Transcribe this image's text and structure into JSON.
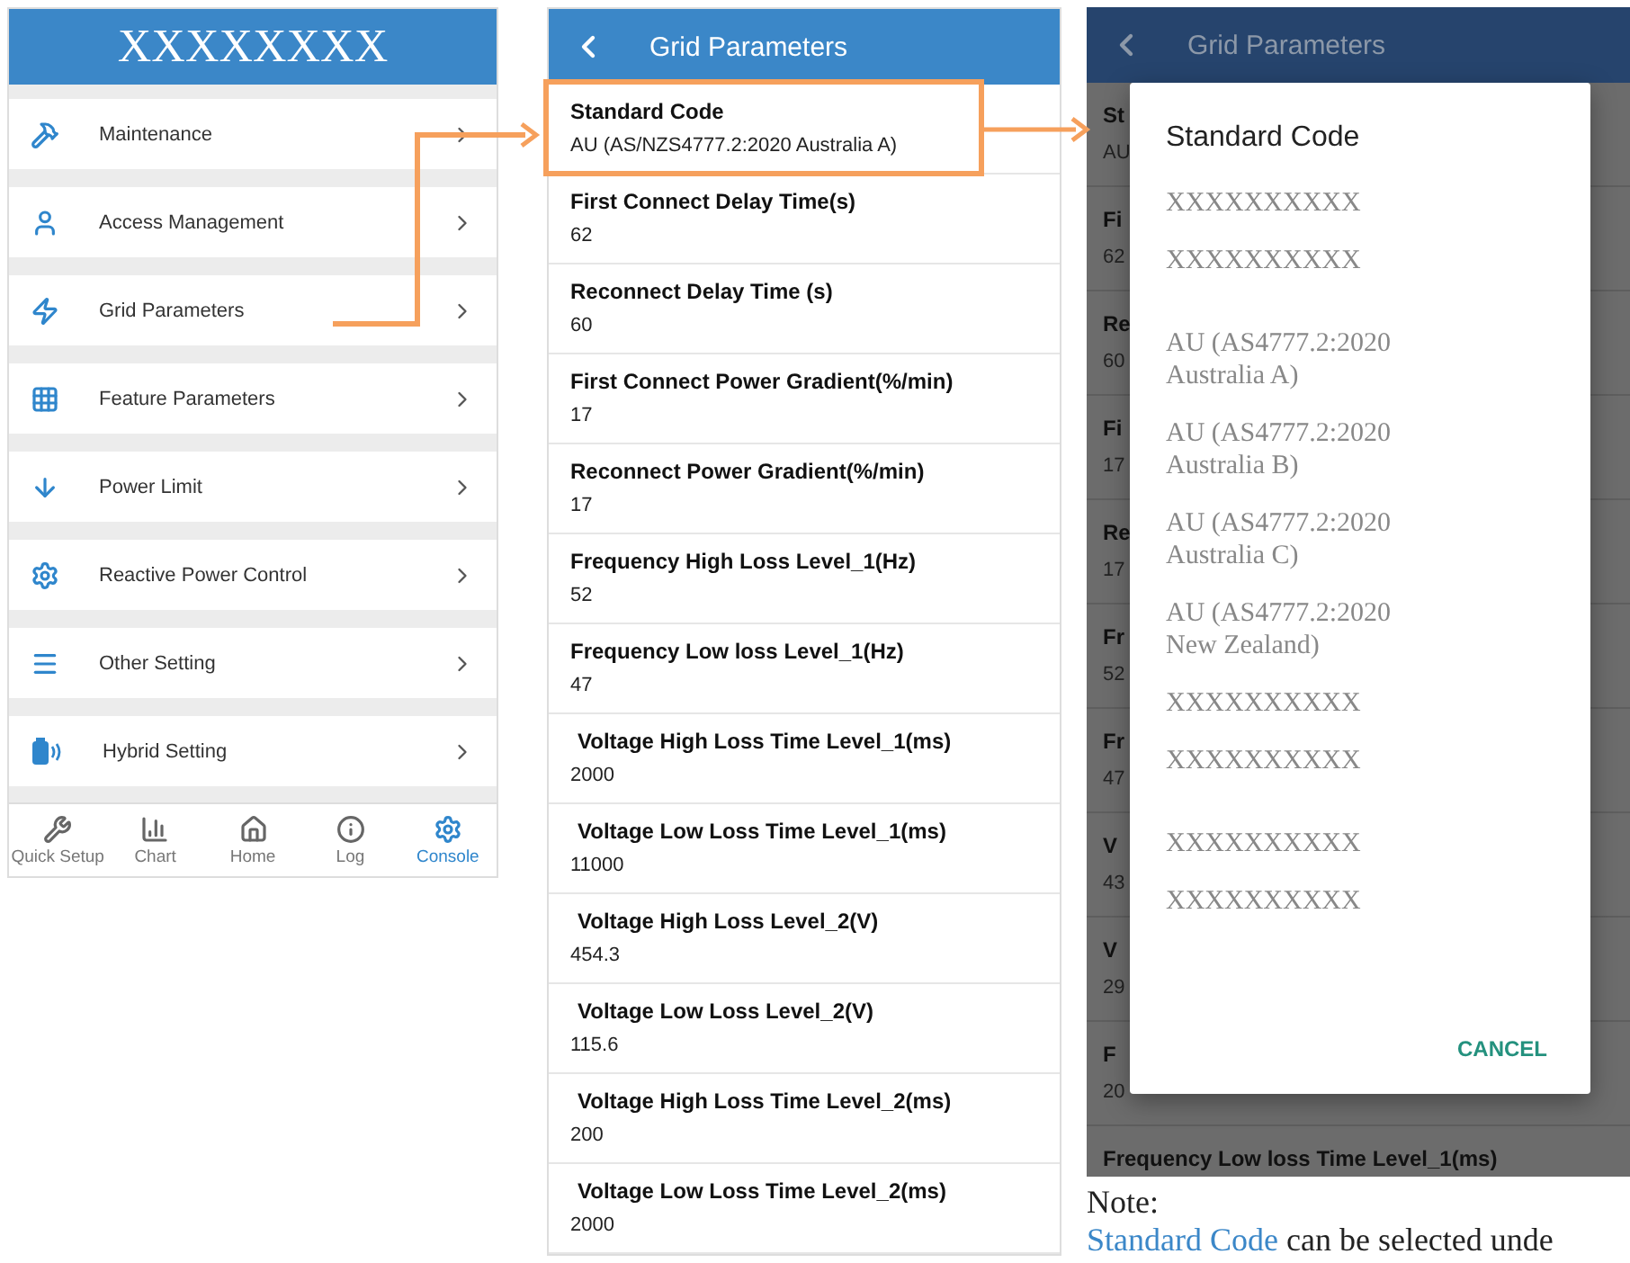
{
  "menu_screen": {
    "title": "XXXXXXXX",
    "items": [
      {
        "label": "Maintenance"
      },
      {
        "label": "Access Management"
      },
      {
        "label": "Grid Parameters"
      },
      {
        "label": "Feature Parameters"
      },
      {
        "label": "Power Limit"
      },
      {
        "label": "Reactive Power Control"
      },
      {
        "label": "Other Setting"
      },
      {
        "label": "Hybrid Setting"
      }
    ],
    "nav": [
      {
        "label": "Quick Setup",
        "selected": false
      },
      {
        "label": "Chart",
        "selected": false
      },
      {
        "label": "Home",
        "selected": false
      },
      {
        "label": "Log",
        "selected": false
      },
      {
        "label": "Console",
        "selected": true
      }
    ]
  },
  "grid_screen": {
    "title": "Grid Parameters",
    "rows": [
      {
        "label": "Standard Code",
        "value": "AU (AS/NZS4777.2:2020 Australia A)"
      },
      {
        "label": "First Connect Delay Time(s)",
        "value": "62"
      },
      {
        "label": "Reconnect Delay Time (s)",
        "value": "60"
      },
      {
        "label": "First Connect Power Gradient(%/min)",
        "value": "17"
      },
      {
        "label": "Reconnect Power Gradient(%/min)",
        "value": "17"
      },
      {
        "label": "Frequency High Loss Level_1(Hz)",
        "value": "52"
      },
      {
        "label": "Frequency Low loss Level_1(Hz)",
        "value": "47"
      },
      {
        "label": "Voltage High Loss Time Level_1(ms)",
        "value": "2000"
      },
      {
        "label": "Voltage Low Loss Time Level_1(ms)",
        "value": "11000"
      },
      {
        "label": "Voltage High Loss Level_2(V)",
        "value": "454.3"
      },
      {
        "label": "Voltage Low Loss Level_2(V)",
        "value": "115.6"
      },
      {
        "label": "Voltage High Loss Time Level_2(ms)",
        "value": "200"
      },
      {
        "label": "Voltage Low Loss Time Level_2(ms)",
        "value": "2000"
      }
    ]
  },
  "dialog_screen": {
    "title": "Grid Parameters",
    "background_rows": [
      {
        "label": "St",
        "value": "AU"
      },
      {
        "label": "Fi",
        "value": "62"
      },
      {
        "label": "Re",
        "value": "60"
      },
      {
        "label": "Fi",
        "value": "17"
      },
      {
        "label": "Re",
        "value": "17"
      },
      {
        "label": "Fr",
        "value": "52"
      },
      {
        "label": "Fr",
        "value": "47"
      },
      {
        "label": "V",
        "value": "43"
      },
      {
        "label": "V",
        "value": "29"
      },
      {
        "label": "F",
        "value": "20"
      },
      {
        "label": "Frequency Low loss Time Level_1(ms)"
      }
    ],
    "dialog": {
      "title": "Standard Code",
      "option_groups": [
        [
          "XXXXXXXXXX",
          "XXXXXXXXXX"
        ],
        [
          "AU (AS4777.2:2020 Australia A)",
          "AU (AS4777.2:2020 Australia B)",
          "AU (AS4777.2:2020 Australia C)",
          "AU (AS4777.2:2020 New Zealand)",
          "XXXXXXXXXX",
          "XXXXXXXXXX"
        ],
        [
          "XXXXXXXXXX",
          "XXXXXXXXXX"
        ]
      ],
      "cancel": "CANCEL"
    }
  },
  "note": {
    "heading": "Note:",
    "link": "Standard Code",
    "text": " can be selected unde"
  }
}
